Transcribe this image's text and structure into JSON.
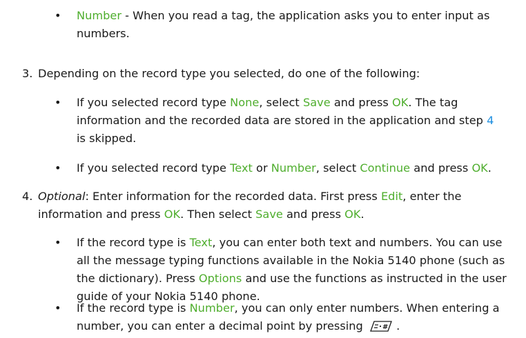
{
  "bullet_number": {
    "term": "Number",
    "text": " - When you read a tag, the application asks you to enter input as numbers."
  },
  "step3": {
    "num": "3.",
    "text": "Depending on the record type you selected, do one of the following:",
    "b1": {
      "a": "If you selected record type ",
      "none": "None",
      "b": ", select ",
      "save": "Save",
      "c": " and press ",
      "ok": "OK",
      "d": ". The tag information and the recorded data are stored in the application and step ",
      "step": "4",
      "e": " is skipped."
    },
    "b2": {
      "a": "If you selected record type ",
      "text": "Text",
      "b": " or ",
      "number": "Number",
      "c": ", select ",
      "continue": "Continue",
      "d": " and press ",
      "ok": "OK",
      "e": "."
    }
  },
  "step4": {
    "num": "4.",
    "optional": "Optional",
    "a": ": Enter information for the recorded data. First press ",
    "edit": "Edit",
    "b": ", enter the information and press ",
    "ok1": "OK",
    "c": ". Then select ",
    "save": "Save",
    "d": " and press ",
    "ok2": "OK",
    "e": ".",
    "b1": {
      "a": "If the record type is ",
      "text": "Text",
      "b": ", you can enter both text and numbers. You can use all the message typing functions available in the Nokia 5140 phone (such as the dictionary). Press ",
      "options": "Options",
      "c": " and use the functions as instructed in the user guide of your Nokia 5140 phone."
    },
    "b2": {
      "a": "If the record type is ",
      "number": "Number",
      "b": ", you can only enter numbers. When entering a number, you can enter a decimal point by pressing ",
      "key_icon": "hash-key-icon",
      "c": " ."
    }
  },
  "colors": {
    "term": "#4fae2e",
    "link": "#1f8fe0"
  }
}
